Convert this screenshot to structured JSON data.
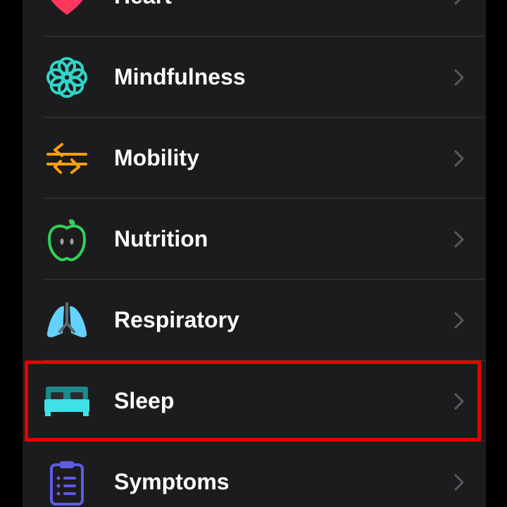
{
  "categories": [
    {
      "label": "Heart",
      "icon": "heart-icon",
      "color": "#ff375f"
    },
    {
      "label": "Mindfulness",
      "icon": "mindfulness-flower-icon",
      "color": "#30d5c8"
    },
    {
      "label": "Mobility",
      "icon": "mobility-arrows-icon",
      "color": "#ff9f0a"
    },
    {
      "label": "Nutrition",
      "icon": "apple-icon",
      "color": "#30d158"
    },
    {
      "label": "Respiratory",
      "icon": "lungs-icon",
      "color": "#64d2ff"
    },
    {
      "label": "Sleep",
      "icon": "bed-icon",
      "color": "#40e0e8"
    },
    {
      "label": "Symptoms",
      "icon": "clipboard-icon",
      "color": "#5e5ce6"
    }
  ],
  "highlighted_item": "Sleep",
  "highlight_color": "#e60000"
}
